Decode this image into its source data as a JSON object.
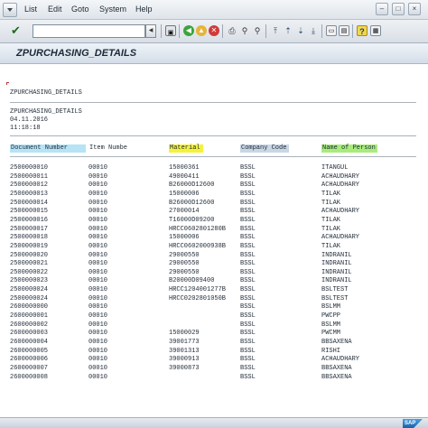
{
  "menubar": {
    "items": [
      {
        "label": "List"
      },
      {
        "label": "Edit"
      },
      {
        "label": "Goto"
      },
      {
        "label": "System"
      },
      {
        "label": "Help"
      }
    ]
  },
  "toolbar": {
    "command_field_value": "",
    "icons": [
      "enter-check-icon",
      "save-icon",
      "back-icon",
      "exit-icon",
      "cancel-icon",
      "print-icon",
      "find-icon",
      "find-next-icon",
      "first-page-icon",
      "previous-page-icon",
      "next-page-icon",
      "last-page-icon",
      "create-session-icon",
      "shortcut-icon",
      "help-icon",
      "layout-menu-icon"
    ]
  },
  "title": "ZPURCHASING_DETAILS",
  "report": {
    "program_name": "ZPURCHASING_DETAILS",
    "header_title": "ZPURCHASING_DETAILS",
    "date": "04.11.2016",
    "time": "11:18:18",
    "columns": [
      {
        "label": "Document Number",
        "color": "#b6e3f6"
      },
      {
        "label": "Item Numbe",
        "color": ""
      },
      {
        "label": "Material",
        "color": "#f6f23a"
      },
      {
        "label": "Company Code",
        "color": "#c9d6e6"
      },
      {
        "label": "Name of Person",
        "color": "#a8ec7c"
      }
    ],
    "rows": [
      [
        "2500000010",
        "00010",
        "15000361",
        "BSSL",
        "ITANGUL"
      ],
      [
        "2500000011",
        "00010",
        "49000411",
        "BSSL",
        "ACHAUDHARY"
      ],
      [
        "2500000012",
        "00010",
        "B26000D12600",
        "BSSL",
        "ACHAUDHARY"
      ],
      [
        "2500000013",
        "00010",
        "15000006",
        "BSSL",
        "TILAK"
      ],
      [
        "2500000014",
        "00010",
        "B26000D12600",
        "BSSL",
        "TILAK"
      ],
      [
        "2500000015",
        "00010",
        "27000014",
        "BSSL",
        "ACHAUDHARY"
      ],
      [
        "2500000016",
        "00010",
        "T16000D09200",
        "BSSL",
        "TILAK"
      ],
      [
        "2500000017",
        "00010",
        "HRCC0602801280B",
        "BSSL",
        "TILAK"
      ],
      [
        "2500000018",
        "00010",
        "15000006",
        "BSSL",
        "ACHAUDHARY"
      ],
      [
        "2500000019",
        "00010",
        "HRCC0602000938B",
        "BSSL",
        "TILAK"
      ],
      [
        "2500000020",
        "00010",
        "29000550",
        "BSSL",
        "INDRANIL"
      ],
      [
        "2500000021",
        "00010",
        "29000550",
        "BSSL",
        "INDRANIL"
      ],
      [
        "2500000022",
        "00010",
        "29000550",
        "BSSL",
        "INDRANIL"
      ],
      [
        "2500000023",
        "00010",
        "B20000D09400",
        "BSSL",
        "INDRANIL"
      ],
      [
        "2500000024",
        "00010",
        "HRCC1204001277B",
        "BSSL",
        "BSLTEST"
      ],
      [
        "2500000024",
        "00010",
        "HRCC0202801050B",
        "BSSL",
        "BSLTEST"
      ],
      [
        "2600000000",
        "00010",
        "",
        "BSSL",
        "BSLMM"
      ],
      [
        "2600000001",
        "00010",
        "",
        "BSSL",
        "PWCPP"
      ],
      [
        "2600000002",
        "00010",
        "",
        "BSSL",
        "BSLMM"
      ],
      [
        "2600000003",
        "00010",
        "15000029",
        "BSSL",
        "PWCMM"
      ],
      [
        "2600000004",
        "00010",
        "39001773",
        "BSSL",
        "BBSAXENA"
      ],
      [
        "2600000005",
        "00010",
        "39001313",
        "BSSL",
        "RISHI"
      ],
      [
        "2600000006",
        "00010",
        "39000913",
        "BSSL",
        "ACHAUDHARY"
      ],
      [
        "2600000007",
        "00010",
        "39000873",
        "BSSL",
        "BBSAXENA"
      ],
      [
        "2600000008",
        "00010",
        "",
        "BSSL",
        "BBSAXENA"
      ]
    ]
  },
  "statusbar": {
    "logo_text": "SAP"
  }
}
